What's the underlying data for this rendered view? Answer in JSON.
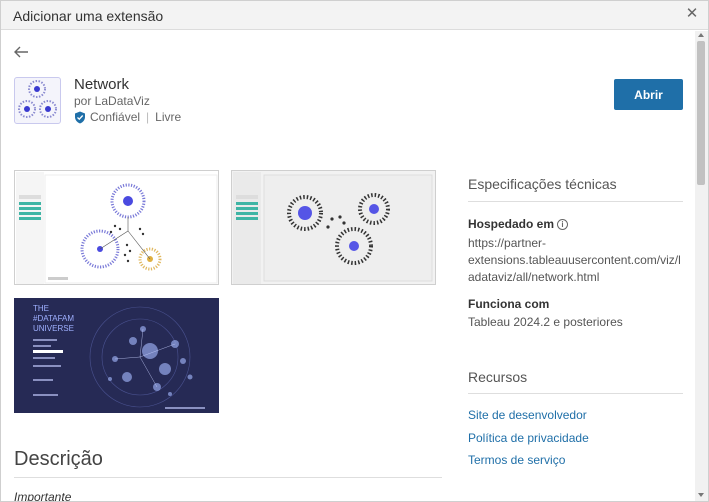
{
  "dialog": {
    "title": "Adicionar uma extensão",
    "close_icon": "close-icon"
  },
  "extension": {
    "name": "Network",
    "author": "por LaDataViz",
    "trust": "Confiável",
    "price": "Livre",
    "open_label": "Abrir",
    "accent": "#1f6fa8"
  },
  "screenshots": {
    "third_overlay": [
      "THE",
      "#DATAFAM",
      "UNIVERSE"
    ]
  },
  "specs": {
    "title": "Especificações técnicas",
    "hosted_label": "Hospedado em",
    "hosted_value_lines": [
      "https://partner-",
      "extensions.tableauusercontent.com/viz/l",
      "adataviz/all/network.html"
    ],
    "works_label": "Funciona com",
    "works_value": "Tableau 2024.2 e posteriores"
  },
  "resources": {
    "title": "Recursos",
    "links": [
      "Site de desenvolvedor",
      "Política de privacidade",
      "Termos de serviço"
    ]
  },
  "description": {
    "title": "Descrição",
    "important": "Importante"
  }
}
